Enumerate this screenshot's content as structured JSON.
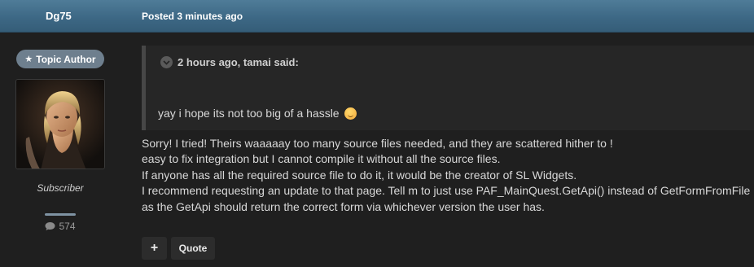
{
  "post": {
    "author": "Dg75",
    "posted": "Posted 3 minutes ago"
  },
  "author_panel": {
    "badge_label": "Topic Author",
    "badge_icon": "star-icon",
    "role": "Subscriber",
    "content_count": "574",
    "count_icon": "comment-icon"
  },
  "quote": {
    "citation": "2 hours ago, tamai said:",
    "text": "yay i hope its not too big of a hassle",
    "emoji": "smiling-face-icon"
  },
  "body": {
    "lines": [
      "Sorry! I tried! Theirs waaaaay too many source files needed, and they are scattered hither to !",
      "easy to fix integration but I cannot compile it without all the source files.",
      "If anyone has all the required source file to do it, it would be the creator of SL Widgets.",
      "I recommend requesting an update to that page. Tell m to just use PAF_MainQuest.GetApi() instead of GetFormFromFile",
      "as the GetApi should return the correct form via whichever version the user has."
    ]
  },
  "actions": {
    "plus_label": "+",
    "quote_label": "Quote"
  },
  "colors": {
    "header": "#3d6885",
    "background": "#1f1f1f",
    "badge": "#6e7f8e",
    "quote_bg": "#262626",
    "quote_border": "#474747"
  }
}
